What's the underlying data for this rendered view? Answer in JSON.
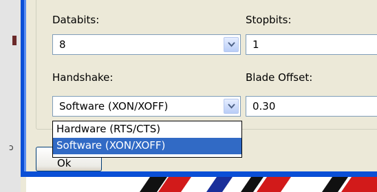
{
  "left_glyph": "ↄ",
  "form": {
    "databits": {
      "label": "Databits:",
      "value": "8"
    },
    "stopbits": {
      "label": "Stopbits:",
      "value": "1"
    },
    "handshake": {
      "label": "Handshake:",
      "value": "Software (XON/XOFF)",
      "options": [
        "Hardware (RTS/CTS)",
        "Software (XON/XOFF)"
      ],
      "selected_index": 1
    },
    "blade_offset": {
      "label": "Blade Offset:",
      "value": "0.30"
    }
  },
  "ok_button": {
    "label": "Ok"
  },
  "colors": {
    "frame_blue": "#0a4fd6",
    "selection_blue": "#316ac5",
    "field_border": "#7f9db9"
  }
}
